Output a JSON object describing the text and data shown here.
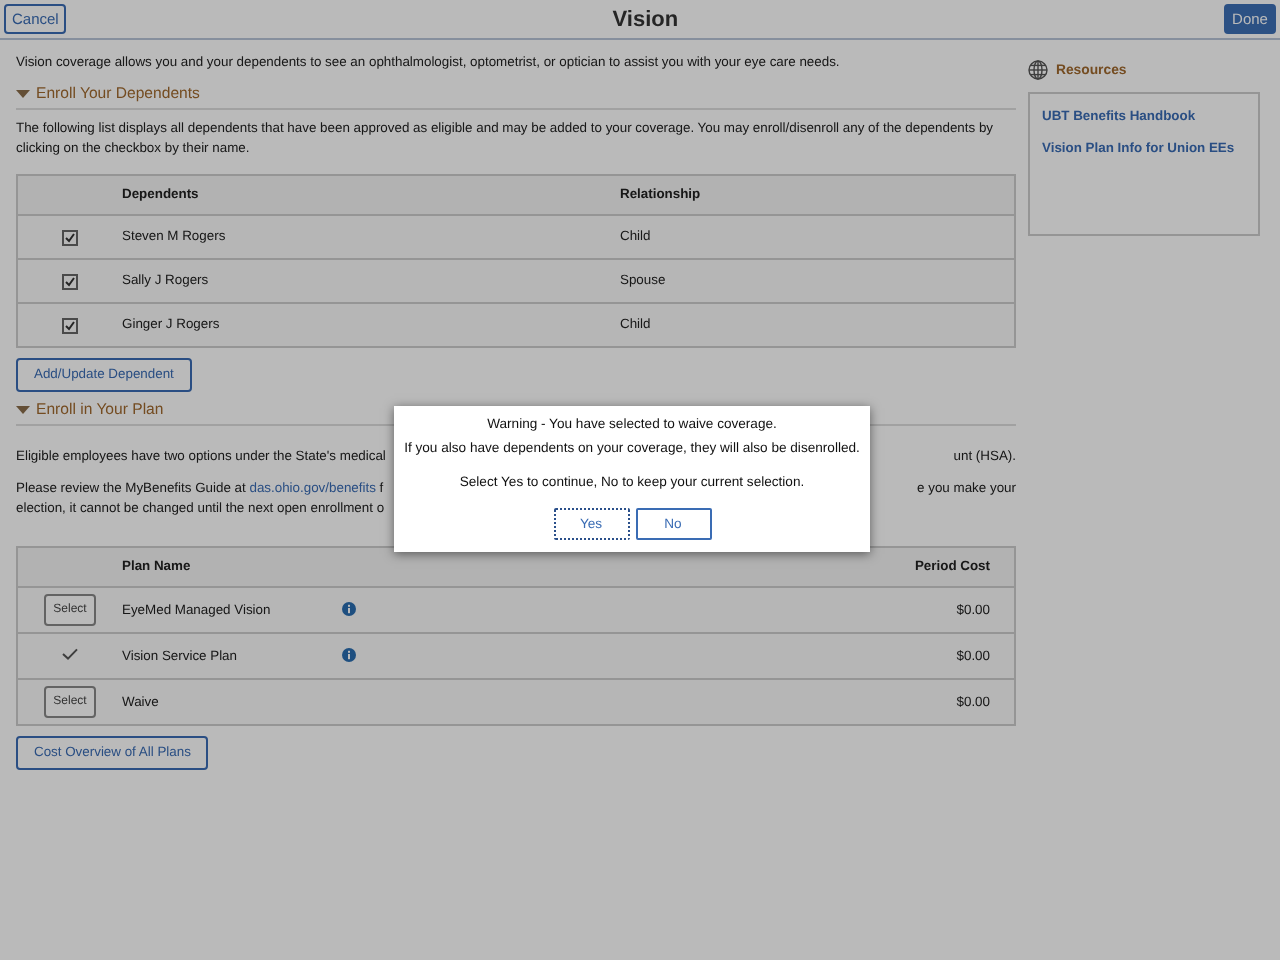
{
  "header": {
    "cancel": "Cancel",
    "title": "Vision",
    "done": "Done"
  },
  "intro": "Vision coverage allows you and your dependents to see an ophthalmologist, optometrist, or optician to assist you with your eye care needs.",
  "dependents_section": {
    "title": "Enroll Your Dependents",
    "expanded": true,
    "description": "The following list displays all dependents that have been approved as eligible and may be added to your coverage. You may enroll/disenroll any of the dependents by clicking on the checkbox by their name.",
    "columns": [
      "Dependents",
      "Relationship"
    ],
    "rows": [
      {
        "name": "Steven M Rogers",
        "relationship": "Child",
        "checked": true
      },
      {
        "name": "Sally J Rogers",
        "relationship": "Spouse",
        "checked": true
      },
      {
        "name": "Ginger J Rogers",
        "relationship": "Child",
        "checked": true
      }
    ],
    "button": "Add/Update Dependent"
  },
  "plan_section": {
    "title": "Enroll in Your Plan",
    "expanded": true,
    "paragraph_1": {
      "left": "Eligible employees have two options under the State's medical",
      "right": "unt (HSA)."
    },
    "paragraph_2": {
      "line_1_left": "Please review the MyBenefits Guide at",
      "link": "das.ohio.gov/benefits",
      "line_1_after_link": "f",
      "line_1_right": "e you make your",
      "line_2_left": "election, it cannot be changed until the next open enrollment o"
    },
    "columns": [
      "Plan Name",
      "Period Cost"
    ],
    "rows": [
      {
        "select_label": "Select",
        "name": "EyeMed Managed Vision",
        "info": true,
        "cost": "$0.00",
        "selected": false
      },
      {
        "name": "Vision Service Plan",
        "info": true,
        "cost": "$0.00",
        "selected": true
      },
      {
        "select_label": "Select",
        "name": "Waive",
        "info": false,
        "cost": "$0.00",
        "selected": false
      }
    ],
    "button": "Cost Overview of All Plans"
  },
  "resources": {
    "title": "Resources",
    "links": [
      "UBT Benefits Handbook",
      "Vision Plan Info for Union EEs"
    ]
  },
  "dialog": {
    "lines": [
      "Warning - You have selected to waive coverage.",
      "If you also have dependents on your coverage, they will also be disenrolled.",
      "Select Yes to continue, No to keep your current selection."
    ],
    "buttons": [
      {
        "label": "Yes",
        "focused": true
      },
      {
        "label": "No",
        "focused": false
      }
    ]
  }
}
